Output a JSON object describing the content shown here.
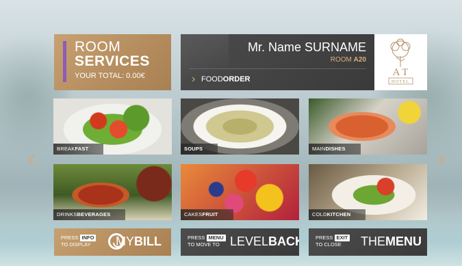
{
  "room_services": {
    "title_line1": "ROOM",
    "title_line2": "SERVICES",
    "total": "YOUR TOTAL: 0.00€"
  },
  "guest": {
    "name": "Mr. Name SURNAME",
    "room_label": "ROOM ",
    "room_number": "A20",
    "section_prefix": "FOOD",
    "section_bold": "ORDER"
  },
  "logo": {
    "monogram": "A T",
    "caption": "HOTEL"
  },
  "menu_tiles": [
    {
      "prefix": "BREAK",
      "bold": "FAST"
    },
    {
      "prefix": "",
      "bold": "SOUPS"
    },
    {
      "prefix": "MAIN",
      "bold": "DISHES"
    },
    {
      "prefix": "DRINKS",
      "bold": "BEVERAGES"
    },
    {
      "prefix": "CAKES",
      "bold": "FRUIT"
    },
    {
      "prefix": "COLD",
      "bold": "KITCHEN"
    }
  ],
  "nav": {
    "left_arrow": "‹",
    "right_arrow": "›"
  },
  "buttons": {
    "bill": {
      "press": "PRESS",
      "key": "INFO",
      "action": "TO DISPLAY",
      "prefix": "MY",
      "bold": "BILL"
    },
    "back": {
      "press": "PRESS",
      "key": "MENU",
      "action": "TO MOVE TO",
      "prefix": "LEVEL",
      "bold": "BACK"
    },
    "menu": {
      "press": "PRESS",
      "key": "EXIT",
      "action": "TO CLOSE",
      "prefix": "THE",
      "bold": "MENU"
    }
  },
  "colors": {
    "accent_gold": "#c7a172",
    "accent_purple": "#8b5db5",
    "dark_panel": "#3f3f40"
  }
}
